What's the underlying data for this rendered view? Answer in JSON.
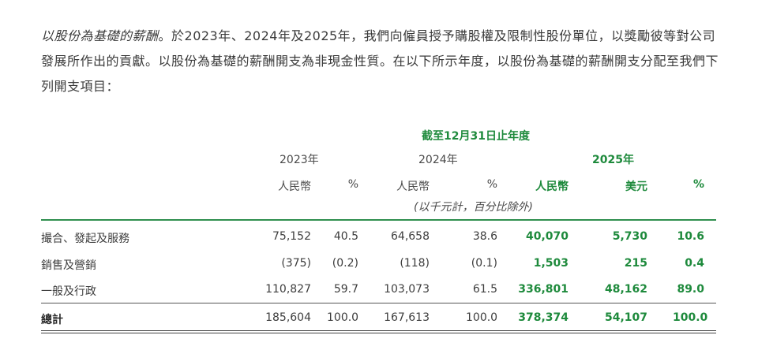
{
  "intro": {
    "lead": "以股份為基礎的薪酬",
    "body": "。於2023年、2024年及2025年，我們向僱員授予購股權及限制性股份單位，以獎勵彼等對公司發展所作出的貢獻。以股份為基礎的薪酬開支為非現金性質。在以下所示年度，以股份為基礎的薪酬開支分配至我們下列開支項目："
  },
  "table": {
    "period_header": "截至12月31日止年度",
    "years": [
      "2023年",
      "2024年",
      "2025年"
    ],
    "columns": [
      "人民幣",
      "%",
      "人民幣",
      "%",
      "人民幣",
      "美元",
      "%"
    ],
    "unit_note": "(以千元計，百分比除外)",
    "rows": [
      {
        "label": "撮合、發起及服務",
        "values": [
          "75,152",
          "40.5",
          "64,658",
          "38.6",
          "40,070",
          "5,730",
          "10.6"
        ]
      },
      {
        "label": "銷售及營銷",
        "values": [
          "(375)",
          "(0.2)",
          "(118)",
          "(0.1)",
          "1,503",
          "215",
          "0.4"
        ]
      },
      {
        "label": "一般及行政",
        "values": [
          "110,827",
          "59.7",
          "103,073",
          "61.5",
          "336,801",
          "48,162",
          "89.0"
        ]
      }
    ],
    "total": {
      "label": "總計",
      "values": [
        "185,604",
        "100.0",
        "167,613",
        "100.0",
        "378,374",
        "54,107",
        "100.0"
      ]
    }
  },
  "colors": {
    "accent_green": "#1e8a3c",
    "rule_green": "#2f8f4e"
  }
}
